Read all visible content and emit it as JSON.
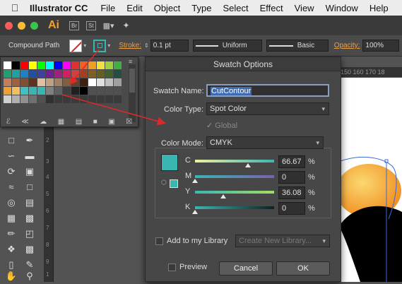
{
  "menubar": {
    "app_name": "Illustrator CC",
    "items": [
      "File",
      "Edit",
      "Object",
      "Type",
      "Select",
      "Effect",
      "View",
      "Window",
      "Help"
    ]
  },
  "appbar": {
    "logo": "Ai",
    "bridge": "Br",
    "stock": "St"
  },
  "controlbar": {
    "selection": "Compound Path",
    "stroke_label": "Stroke:",
    "stroke_value": "0.1 pt",
    "profile": "Uniform",
    "brush": "Basic",
    "opacity_label": "Opacity:",
    "opacity_value": "100%"
  },
  "ruler": {
    "ticks": "150  160  170  18",
    "v_ticks": [
      "2",
      "3",
      "4",
      "5",
      "6",
      "7",
      "8",
      "9",
      "1",
      "1"
    ]
  },
  "dialog": {
    "title": "Swatch Options",
    "swatch_name_label": "Swatch Name:",
    "swatch_name_value": "CutContour",
    "color_type_label": "Color Type:",
    "color_type_value": "Spot Color",
    "global_label": "Global",
    "color_mode_label": "Color Mode:",
    "color_mode_value": "CMYK",
    "channels": [
      {
        "label": "C",
        "value": "66.67",
        "unit": "%",
        "level": 0.6667
      },
      {
        "label": "M",
        "value": "0",
        "unit": "%",
        "level": 0
      },
      {
        "label": "Y",
        "value": "36.08",
        "unit": "%",
        "level": 0.3608
      },
      {
        "label": "K",
        "value": "0",
        "unit": "%",
        "level": 0
      }
    ],
    "library_label": "Add to my Library",
    "library_select": "Create New Library...",
    "preview_label": "Preview",
    "cancel_label": "Cancel",
    "ok_label": "OK"
  },
  "colors": {
    "swatch_color": "#3ab6b2",
    "accent_arrow": "#e02828",
    "opacity_orange": "#e8a04a"
  }
}
